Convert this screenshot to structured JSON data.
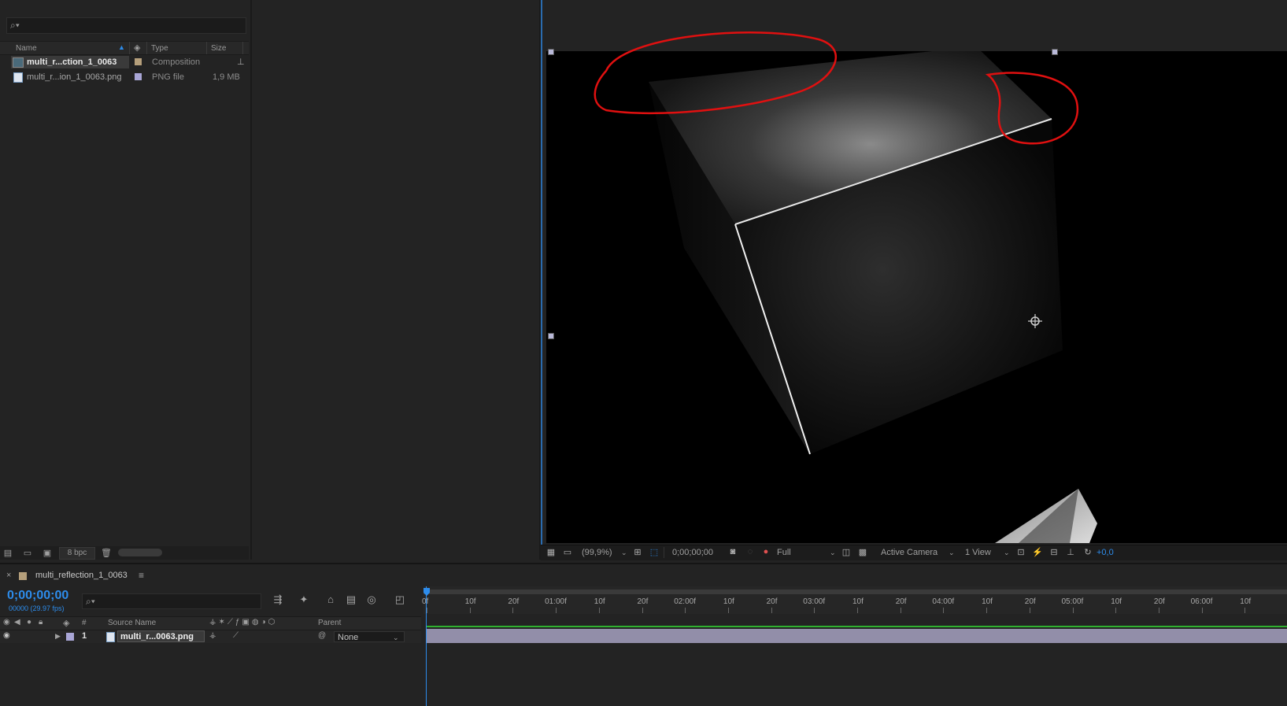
{
  "project_panel": {
    "columns": {
      "name": "Name",
      "type": "Type",
      "size": "Size"
    },
    "items": [
      {
        "name": "multi_r...ction_1_0063",
        "type": "Composition",
        "size": "",
        "label_color": "#b59f7b"
      },
      {
        "name": "multi_r...ion_1_0063.png",
        "type": "PNG file",
        "size": "1,9 MB",
        "label_color": "#a9a6d6"
      }
    ],
    "footer": {
      "bpc": "8 bpc"
    }
  },
  "viewer": {
    "zoom": "(99,9%)",
    "timecode": "0;00;00;00",
    "resolution": "Full",
    "camera": "Active Camera",
    "views": "1 View",
    "exposure": "+0,0"
  },
  "timeline": {
    "tab_title": "multi_reflection_1_0063",
    "current_time": "0;00;00;00",
    "fps_info": "00000 (29.97 fps)",
    "columns": {
      "number": "#",
      "source_name": "Source Name",
      "parent": "Parent"
    },
    "layers": [
      {
        "number": "1",
        "source_name": "multi_r...0063.png",
        "parent": "None",
        "label_color": "#a9a6d6"
      }
    ],
    "ruler_labels": [
      "0f",
      "10f",
      "20f",
      "01:00f",
      "10f",
      "20f",
      "02:00f",
      "10f",
      "20f",
      "03:00f",
      "10f",
      "20f",
      "04:00f",
      "10f",
      "20f",
      "05:00f",
      "10f",
      "20f",
      "06:00f",
      "10f"
    ]
  },
  "colors": {
    "accent": "#2d8ceb",
    "annotation": "#e01010"
  }
}
